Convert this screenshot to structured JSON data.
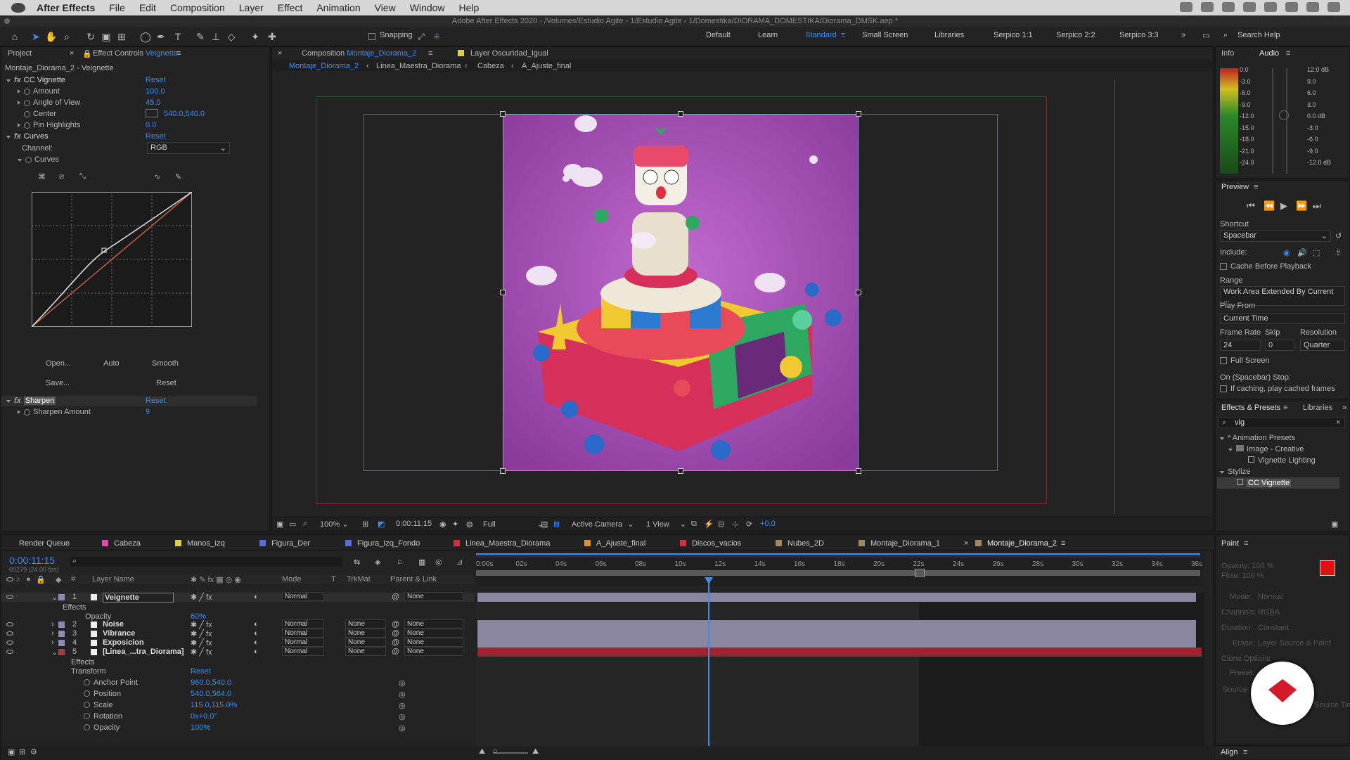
{
  "menubar": {
    "app": "After Effects",
    "items": [
      "File",
      "Edit",
      "Composition",
      "Layer",
      "Effect",
      "Animation",
      "View",
      "Window",
      "Help"
    ]
  },
  "titlebar": {
    "text": "Adobe After Effects 2020 - /Volumes/Estudio Agite - 1/Estudio Agite - 1/Domestika/DIORAMA_DOMESTIKA/Diorama_DMSK.aep *"
  },
  "toolbar": {
    "snapping": "Snapping",
    "workspaces": [
      "Default",
      "Learn",
      "Standard",
      "Small Screen",
      "Libraries",
      "Serpico 1:1",
      "Serpico 2:2",
      "Serpico 3:3"
    ],
    "active_workspace": "Standard",
    "search_help": "Search Help"
  },
  "project_panel": {
    "tab_project": "Project",
    "tab_effect_controls": "Effect Controls",
    "effect_controls_layer": "Veignette",
    "subtitle": "Montaje_Diorama_2 - Veignette",
    "effects": [
      {
        "name": "CC Vignette",
        "reset": "Reset",
        "props": [
          {
            "label": "Amount",
            "value": "100.0"
          },
          {
            "label": "Angle of View",
            "value": "45.0"
          },
          {
            "label": "Center",
            "value": "540.0,540.0"
          },
          {
            "label": "Pin Highlights",
            "value": "0.0"
          }
        ]
      },
      {
        "name": "Curves",
        "reset": "Reset",
        "channel_label": "Channel:",
        "channel_value": "RGB",
        "curves_label": "Curves",
        "buttons": [
          "Open...",
          "Auto",
          "Smooth",
          "Save...",
          "Reset"
        ]
      },
      {
        "name": "Sharpen",
        "reset": "Reset",
        "props": [
          {
            "label": "Sharpen Amount",
            "value": "9"
          }
        ]
      }
    ]
  },
  "comp_panel": {
    "tabs": [
      {
        "label": "Composition",
        "name": "Montaje_Diorama_2"
      },
      {
        "label": "Layer",
        "name": "Layer Oscuridad_Igual"
      }
    ],
    "breadcrumb": [
      "Montaje_Diorama_2",
      "Linea_Maestra_Diorama",
      "Cabeza",
      "A_Ajuste_final"
    ],
    "footer": {
      "zoom": "100%",
      "timecode": "0:00:11:15",
      "resolution": "Full",
      "camera": "Active Camera",
      "view": "1 View",
      "exposure": "+0.0"
    }
  },
  "info_panel": {
    "tab_info": "Info",
    "tab_audio": "Audio",
    "db_left": [
      "0.0",
      "-3.0",
      "-6.0",
      "-9.0",
      "-12.0",
      "-15.0",
      "-18.0",
      "-21.0",
      "-24.0"
    ],
    "db_right": [
      "12.0 dB",
      "9.0",
      "6.0",
      "3.0",
      "0.0 dB",
      "-3.0",
      "-6.0",
      "-9.0",
      "-12.0 dB"
    ]
  },
  "preview_panel": {
    "title": "Preview",
    "shortcut_label": "Shortcut",
    "shortcut_value": "Spacebar",
    "include_label": "Include:",
    "cache_label": "Cache Before Playback",
    "range_label": "Range",
    "range_value": "Work Area Extended By Current ...",
    "play_from_label": "Play From",
    "play_from_value": "Current Time",
    "frame_rate_label": "Frame Rate",
    "skip_label": "Skip",
    "resolution_label": "Resolution",
    "frame_rate_value": "24",
    "skip_value": "0",
    "resolution_value": "Quarter",
    "full_screen_label": "Full Screen",
    "stop_label": "On (Spacebar) Stop:",
    "stop_option": "If caching, play cached frames"
  },
  "effects_presets": {
    "tab": "Effects & Presets",
    "tab2": "Libraries",
    "search_value": "vig",
    "tree": [
      {
        "label": "* Animation Presets",
        "indent": 0
      },
      {
        "label": "Image - Creative",
        "indent": 1
      },
      {
        "label": "Vignette Lighting",
        "indent": 2
      },
      {
        "label": "Stylize",
        "indent": 0
      },
      {
        "label": "CC Vignette",
        "indent": 1
      }
    ]
  },
  "timeline": {
    "tabs": [
      {
        "label": "Render Queue",
        "color": ""
      },
      {
        "label": "Cabeza",
        "color": "#e04bb0"
      },
      {
        "label": "Manos_Izq",
        "color": "#e0d040"
      },
      {
        "label": "Figura_Der",
        "color": "#5a6be0"
      },
      {
        "label": "Figura_Izq_Fondo",
        "color": "#5a6be0"
      },
      {
        "label": "Linea_Maestra_Diorama",
        "color": "#d03040"
      },
      {
        "label": "A_Ajuste_final",
        "color": "#e0902a"
      },
      {
        "label": "Discos_vacios",
        "color": "#d03040"
      },
      {
        "label": "Nubes_2D",
        "color": "#a08a60"
      },
      {
        "label": "Montaje_Diorama_1",
        "color": "#a08a60"
      },
      {
        "label": "Montaje_Diorama_2",
        "color": "#a08a60"
      }
    ],
    "timecode": "0:00:11:15",
    "frames": "00279 (24.00 fps)",
    "columns": {
      "num": "#",
      "layer_name": "Layer Name",
      "mode": "Mode",
      "t": "T",
      "trkmat": "TrkMat",
      "parent": "Parent & Link"
    },
    "ticks": [
      "0:00s",
      "02s",
      "04s",
      "06s",
      "08s",
      "10s",
      "12s",
      "14s",
      "16s",
      "18s",
      "20s",
      "22s",
      "24s",
      "26s",
      "28s",
      "30s",
      "32s",
      "34s",
      "36s"
    ],
    "layers": [
      {
        "num": "1",
        "name": "Veignette",
        "mode": "Normal",
        "trkmat": "",
        "parent": "None",
        "color": "#9088b8"
      },
      {
        "num": "2",
        "name": "Noise",
        "mode": "Normal",
        "trkmat": "None",
        "parent": "None",
        "color": "#9088b8"
      },
      {
        "num": "3",
        "name": "Vibrance",
        "mode": "Normal",
        "trkmat": "None",
        "parent": "None",
        "color": "#9088b8"
      },
      {
        "num": "4",
        "name": "Exposicion",
        "mode": "Normal",
        "trkmat": "None",
        "parent": "None",
        "color": "#9088b8"
      },
      {
        "num": "5",
        "name": "[Linea_...tra_Diorama]",
        "mode": "Normal",
        "trkmat": "None",
        "parent": "None",
        "color": "#c03040"
      }
    ],
    "effects_label": "Effects",
    "opacity_label": "Opacity",
    "opacity_value": "60%",
    "transform_label": "Transform",
    "transform_reset": "Reset",
    "transform": [
      {
        "label": "Anchor Point",
        "value": "960.0,540.0"
      },
      {
        "label": "Position",
        "value": "540.0,564.0"
      },
      {
        "label": "Scale",
        "value": "115.0,115.0%"
      },
      {
        "label": "Rotation",
        "value": "0x+0.0°"
      },
      {
        "label": "Opacity",
        "value": "100%"
      }
    ]
  },
  "paint_panel": {
    "title": "Paint",
    "opacity": "Opacity: 100 %",
    "flow": "Flow: 100 %",
    "mode_label": "Mode:",
    "mode": "Normal",
    "channels_label": "Channels:",
    "channels": "RGBA",
    "duration_label": "Duration:",
    "duration": "Constant",
    "erase_label": "Erase:",
    "erase": "Layer Source & Paint",
    "clone": "Clone Options",
    "preset": "Preset:",
    "source": "Source:",
    "source_time": "Source Time",
    "align": "Align"
  },
  "colors": {
    "accent": "#3d8cf0",
    "playhead": "#3d8cf0",
    "red_swatch": "#e01010",
    "logo": "#d41a2a"
  }
}
